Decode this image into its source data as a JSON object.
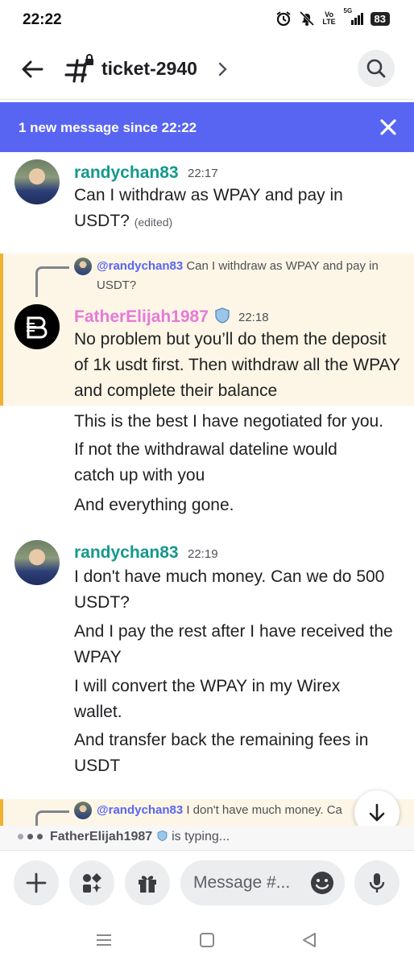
{
  "status_bar": {
    "time": "22:22",
    "signal_label": "Vo LTE",
    "network": "5G",
    "battery": "83"
  },
  "header": {
    "channel_name": "ticket-2940"
  },
  "banner": {
    "text": "1 new message since 22:22"
  },
  "messages": [
    {
      "author": "randychan83",
      "author_color": "#14998c",
      "time": "22:17",
      "lines": [
        "Can I withdraw as WPAY and pay in USDT?"
      ],
      "edited_label": "(edited)"
    },
    {
      "reply_to": "@randychan83",
      "reply_text": "Can I withdraw as WPAY and pay in USDT?",
      "author": "FatherElijah1987",
      "author_color": "#e879d7",
      "time": "22:18",
      "lines": [
        "No problem but you’ll do them the deposit of 1k usdt first. Then withdraw all the WPAY and complete their balance",
        "This is the best I have negotiated for you.",
        "If not the withdrawal dateline would catch up with you",
        "And everything gone."
      ]
    },
    {
      "author": "randychan83",
      "author_color": "#14998c",
      "time": "22:19",
      "lines": [
        "I don't have much money. Can we do 500 USDT?",
        "And I pay the rest after I have received the WPAY",
        "I will convert the WPAY in my Wirex wallet.",
        "And transfer back the remaining fees in USDT"
      ]
    }
  ],
  "partial_reply": {
    "mention": "@randychan83",
    "text": "I don't have much money. Ca"
  },
  "typing": {
    "user": "FatherElijah1987",
    "text": "is typing..."
  },
  "composer": {
    "placeholder": "Message #..."
  },
  "colors": {
    "accent": "#5865f2",
    "highlight_bg": "#fdf6e6",
    "highlight_border": "#f0b232"
  }
}
